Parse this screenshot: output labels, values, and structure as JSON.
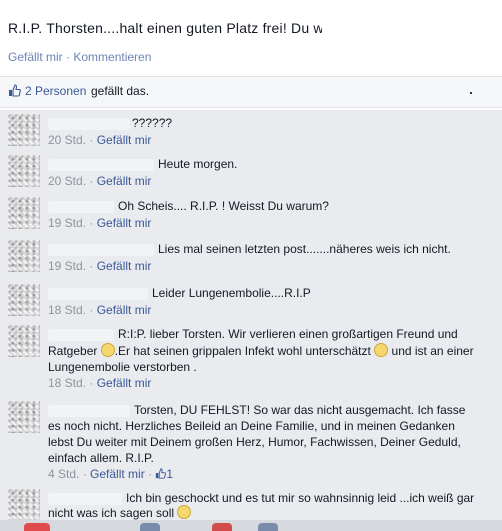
{
  "post": {
    "text": "R.I.P. Thorsten....halt einen guten Platz frei! Du wir",
    "like_label": "Gefällt mir",
    "separator": " · ",
    "comment_label": "Kommentieren"
  },
  "likes": {
    "count_label": "2 Personen",
    "suffix": "gefällt das."
  },
  "comments": [
    {
      "text": "??????",
      "time": "20 Std.",
      "like_label": "Gefällt mir"
    },
    {
      "text": "Heute morgen.",
      "time": "20 Std.",
      "like_label": "Gefällt mir"
    },
    {
      "text": "Oh Scheis.... R.I.P. ! Weisst Du warum?",
      "time": "19 Std.",
      "like_label": "Gefällt mir"
    },
    {
      "text": "Lies mal seinen letzten post.......näheres weis ich nicht.",
      "time": "19 Std.",
      "like_label": "Gefällt mir"
    },
    {
      "text": "Leider Lungenembolie....R.I.P",
      "time": "18 Std.",
      "like_label": "Gefällt mir"
    },
    {
      "text_a": "R:I:P. lieber Torsten. Wir verlieren einen großartigen Freund und",
      "text_b": "Ratgeber ",
      "text_c": ".Er hat seinen grippalen Infekt wohl unterschätzt ",
      "text_d": " und ist an einer",
      "text_e": "Lungenembolie verstorben .",
      "time": "18 Std.",
      "like_label": "Gefällt mir"
    },
    {
      "text_a": "Torsten, DU FEHLST! So war das nicht ausgemacht. Ich fasse",
      "text_b": "es noch nicht. Herzliches Beileid an Deine Familie, und in meinen Gedanken",
      "text_c": "lebst Du weiter mit Deinem großen Herz, Humor, Fachwissen, Deiner Geduld,",
      "text_d": "einfach allem. R.I.P.",
      "time": "4 Std.",
      "like_label": "Gefällt mir",
      "likes": "1"
    },
    {
      "text_a": "Ich bin geschockt und es tut mir so wahnsinnig leid ...ich weiß gar",
      "text_b": "nicht was ich sagen soll "
    }
  ],
  "colors": {
    "link": "#3b5998",
    "meta": "#90949c",
    "background": "#e9ebee"
  }
}
